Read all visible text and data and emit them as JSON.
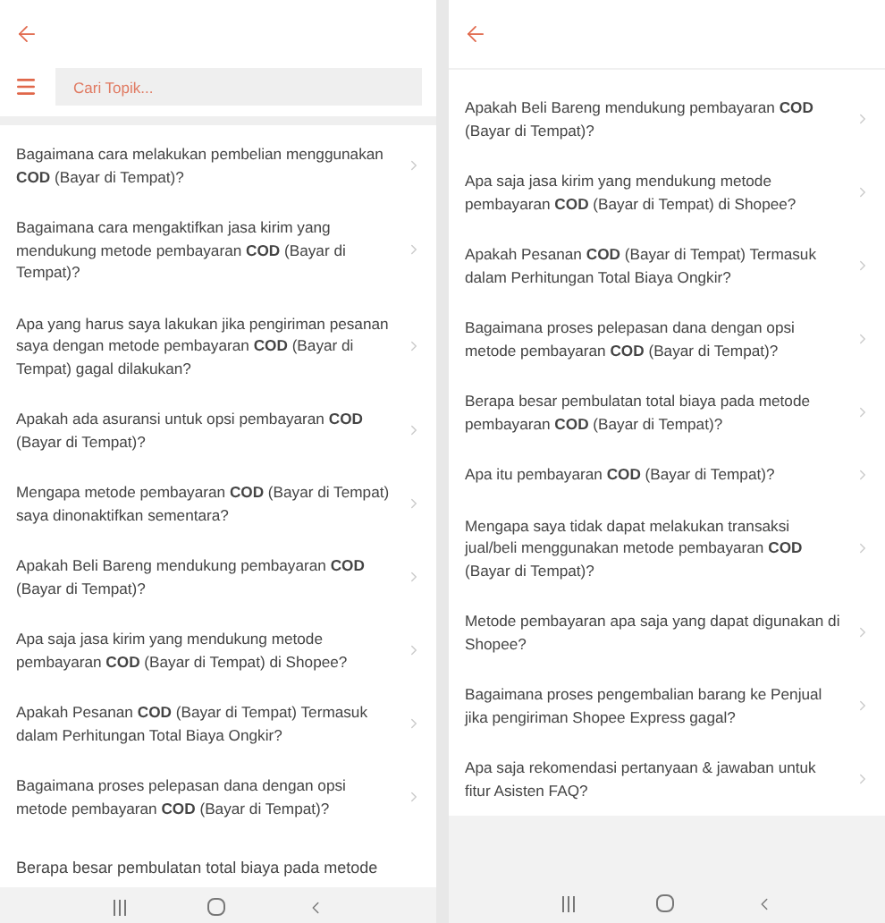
{
  "panes": [
    {
      "search": {
        "placeholder": "Cari Topik..."
      },
      "questions": [
        "Bagaimana cara melakukan pembelian menggunakan **COD** (Bayar di Tempat)?",
        "Bagaimana cara mengaktifkan jasa kirim yang mendukung metode pembayaran **COD** (Bayar di Tempat)?",
        "Apa yang harus saya lakukan jika pengiriman pesanan saya dengan metode pembayaran **COD** (Bayar di Tempat) gagal dilakukan?",
        "Apakah ada asuransi untuk opsi pembayaran **COD** (Bayar di Tempat)?",
        "Mengapa metode pembayaran **COD** (Bayar di Tempat) saya dinonaktifkan sementara?",
        "Apakah Beli Bareng mendukung pembayaran **COD** (Bayar di Tempat)?",
        "Apa saja jasa kirim yang mendukung metode pembayaran **COD** (Bayar di Tempat) di Shopee?",
        "Apakah Pesanan **COD** (Bayar di Tempat) Termasuk dalam Perhitungan Total Biaya Ongkir?",
        "Bagaimana proses pelepasan dana dengan opsi metode pembayaran **COD** (Bayar di Tempat)?"
      ],
      "cut_question": "Berapa besar pembulatan total biaya pada metode"
    },
    {
      "questions": [
        "Apakah Beli Bareng mendukung pembayaran **COD** (Bayar di Tempat)?",
        "Apa saja jasa kirim yang mendukung metode pembayaran **COD** (Bayar di Tempat) di Shopee?",
        "Apakah Pesanan **COD** (Bayar di Tempat) Termasuk dalam Perhitungan Total Biaya Ongkir?",
        "Bagaimana proses pelepasan dana dengan opsi metode pembayaran **COD** (Bayar di Tempat)?",
        "Berapa besar pembulatan total biaya pada metode pembayaran **COD** (Bayar di Tempat)?",
        "Apa itu pembayaran **COD** (Bayar di Tempat)?",
        "Mengapa saya tidak dapat melakukan transaksi jual/beli menggunakan metode pembayaran **COD** (Bayar di Tempat)?",
        "Metode pembayaran apa saja yang dapat digunakan di Shopee?",
        "Bagaimana proses pengembalian barang ke Penjual jika pengiriman Shopee Express gagal?",
        "Apa saja rekomendasi pertanyaan & jawaban untuk fitur Asisten FAQ?"
      ]
    }
  ]
}
